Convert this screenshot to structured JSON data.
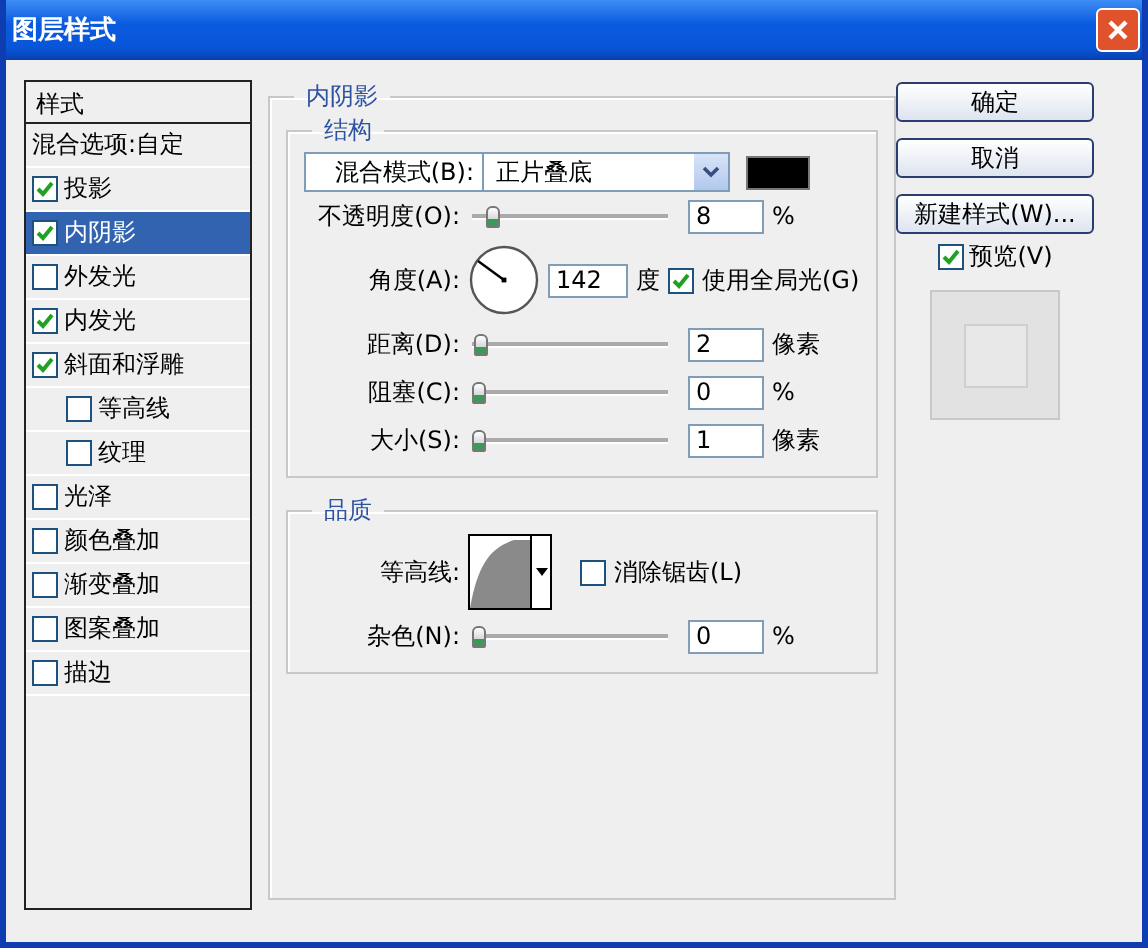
{
  "window": {
    "title": "图层样式"
  },
  "styles_panel": {
    "header": "样式",
    "items": [
      {
        "kind": "option",
        "label": "混合选项:自定",
        "selected": false
      },
      {
        "kind": "check",
        "label": "投影",
        "checked": true,
        "selected": false
      },
      {
        "kind": "check",
        "label": "内阴影",
        "checked": true,
        "selected": true
      },
      {
        "kind": "check",
        "label": "外发光",
        "checked": false,
        "selected": false
      },
      {
        "kind": "check",
        "label": "内发光",
        "checked": true,
        "selected": false
      },
      {
        "kind": "check",
        "label": "斜面和浮雕",
        "checked": true,
        "selected": false,
        "children": [
          {
            "kind": "check",
            "label": "等高线",
            "checked": false,
            "selected": false
          },
          {
            "kind": "check",
            "label": "纹理",
            "checked": false,
            "selected": false
          }
        ]
      },
      {
        "kind": "check",
        "label": "光泽",
        "checked": false,
        "selected": false
      },
      {
        "kind": "check",
        "label": "颜色叠加",
        "checked": false,
        "selected": false
      },
      {
        "kind": "check",
        "label": "渐变叠加",
        "checked": false,
        "selected": false
      },
      {
        "kind": "check",
        "label": "图案叠加",
        "checked": false,
        "selected": false
      },
      {
        "kind": "check",
        "label": "描边",
        "checked": false,
        "selected": false
      }
    ]
  },
  "inner_shadow": {
    "title": "内阴影",
    "structure": {
      "title": "结构",
      "rows": [
        {
          "kind": "select",
          "label": "混合模式(B):",
          "value": "正片叠底"
        },
        {
          "kind": "slider",
          "label": "不透明度(O):",
          "value": "8",
          "unit": "%",
          "level": 0.08
        },
        {
          "kind": "angle",
          "label": "角度(A):",
          "value": "142",
          "unit": "度",
          "global_light": {
            "label": "使用全局光(G)",
            "checked": true
          }
        },
        {
          "kind": "slider",
          "label": "距离(D):",
          "value": "2",
          "unit": "像素",
          "level": 0.01
        },
        {
          "kind": "slider",
          "label": "阻塞(C):",
          "value": "0",
          "unit": "%",
          "level": 0
        },
        {
          "kind": "slider",
          "label": "大小(S):",
          "value": "1",
          "unit": "像素",
          "level": 0.004
        }
      ]
    },
    "quality": {
      "title": "品质",
      "contour": {
        "label": "等高线:"
      },
      "anti_alias": {
        "label": "消除锯齿(L)",
        "checked": false
      },
      "noise": {
        "label": "杂色(N):",
        "value": "0",
        "unit": "%",
        "level": 0
      }
    }
  },
  "buttons": [
    "确定",
    "取消",
    "新建样式(W)..."
  ],
  "preview": {
    "label": "预览(V)",
    "checked": true
  }
}
